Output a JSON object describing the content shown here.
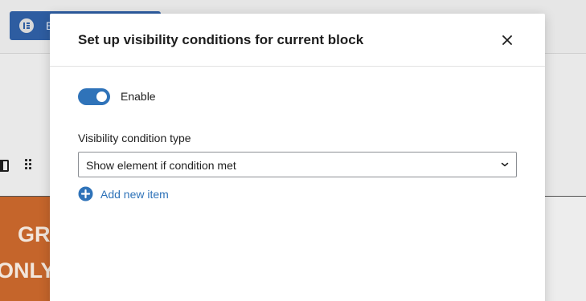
{
  "background": {
    "editor_button_letter": "E",
    "orange_block_lines": [
      "GR",
      "ONLY"
    ]
  },
  "modal": {
    "title": "Set up visibility conditions for current block",
    "enable_toggle": {
      "label": "Enable",
      "checked": true
    },
    "condition_type": {
      "label": "Visibility condition type",
      "value": "Show element if condition met"
    },
    "add_item_label": "Add new item"
  },
  "colors": {
    "accent": "#2f73b9",
    "editor_button": "#2e5da1",
    "orange_block": "#c5652b"
  },
  "icons": {
    "close": "close-icon",
    "chevron": "chevron-down-icon",
    "add": "plus-circle-icon",
    "editor_logo": "elementor-logo-icon",
    "block": "block-icon",
    "drag": "drag-handle-icon"
  }
}
